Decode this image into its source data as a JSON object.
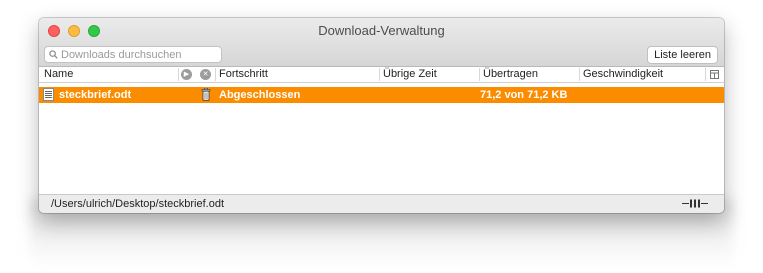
{
  "window": {
    "title": "Download-Verwaltung"
  },
  "toolbar": {
    "search_placeholder": "Downloads durchsuchen",
    "clear_label": "Liste leeren"
  },
  "table": {
    "columns": [
      "Name",
      "Fortschritt",
      "Übrige Zeit",
      "Übertragen",
      "Geschwindigkeit"
    ],
    "rows": [
      {
        "name": "steckbrief.odt",
        "progress": "Abgeschlossen",
        "remaining": "",
        "transferred": "71,2 von 71,2 KB",
        "speed": ""
      }
    ]
  },
  "status": {
    "path": "/Users/ulrich/Desktop/steckbrief.odt"
  },
  "colors": {
    "selection": "#fb8c00",
    "close": "#fc615d",
    "minimize": "#fdbc40",
    "maximize": "#34c84a"
  },
  "icons": [
    "close-light",
    "minimize-light",
    "maximize-light",
    "search-icon",
    "resume-all-icon",
    "cancel-all-icon",
    "column-options-icon",
    "document-icon",
    "trash-icon",
    "resize-handle-icon"
  ]
}
